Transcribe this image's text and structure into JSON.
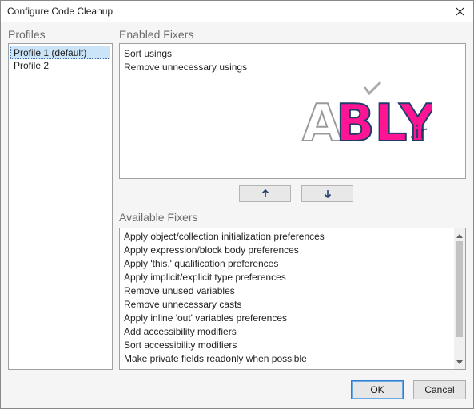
{
  "window": {
    "title": "Configure Code Cleanup"
  },
  "profiles": {
    "label": "Profiles",
    "items": [
      "Profile 1 (default)",
      "Profile 2"
    ]
  },
  "enabled": {
    "label": "Enabled Fixers",
    "items": [
      "Sort usings",
      "Remove unnecessary usings"
    ]
  },
  "watermark": {
    "text": "ABLY",
    "suffix": ".ir"
  },
  "available": {
    "label": "Available Fixers",
    "items": [
      "Apply object/collection initialization preferences",
      "Apply expression/block body preferences",
      "Apply 'this.' qualification preferences",
      "Apply implicit/explicit type preferences",
      "Remove unused variables",
      "Remove unnecessary casts",
      "Apply inline 'out' variables preferences",
      "Add accessibility modifiers",
      "Sort accessibility modifiers",
      "Make private fields readonly when possible"
    ]
  },
  "buttons": {
    "ok": "OK",
    "cancel": "Cancel"
  },
  "colors": {
    "selection": "#cce4f7",
    "arrow": "#1f3d6b",
    "logo_pink": "#ff1493"
  }
}
